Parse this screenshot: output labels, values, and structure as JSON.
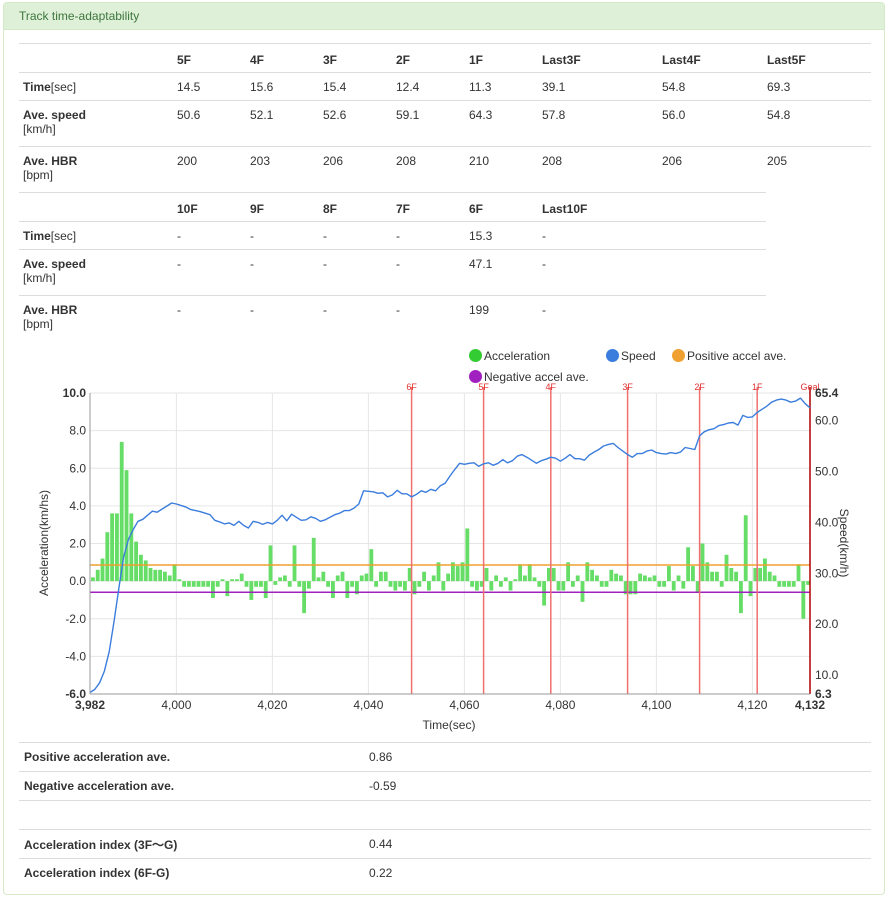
{
  "panel": {
    "title": "Track time-adaptability"
  },
  "table1": {
    "headers": [
      "",
      "5F",
      "4F",
      "3F",
      "2F",
      "1F",
      "Last3F",
      "Last4F",
      "Last5F"
    ],
    "rows": [
      {
        "label": "Time",
        "unit": "[sec]",
        "values": [
          "14.5",
          "15.6",
          "15.4",
          "12.4",
          "11.3",
          "39.1",
          "54.8",
          "69.3"
        ]
      },
      {
        "label": "Ave. speed",
        "unit": "[km/h]",
        "values": [
          "50.6",
          "52.1",
          "52.6",
          "59.1",
          "64.3",
          "57.8",
          "56.0",
          "54.8"
        ]
      },
      {
        "label": "Ave. HBR",
        "unit": "[bpm]",
        "values": [
          "200",
          "203",
          "206",
          "208",
          "210",
          "208",
          "206",
          "205"
        ]
      }
    ]
  },
  "table2": {
    "headers": [
      "",
      "10F",
      "9F",
      "8F",
      "7F",
      "6F",
      "Last10F"
    ],
    "rows": [
      {
        "label": "Time",
        "unit": "[sec]",
        "values": [
          "-",
          "-",
          "-",
          "-",
          "15.3",
          "-"
        ]
      },
      {
        "label": "Ave. speed",
        "unit": "[km/h]",
        "values": [
          "-",
          "-",
          "-",
          "-",
          "47.1",
          "-"
        ]
      },
      {
        "label": "Ave. HBR",
        "unit": "[bpm]",
        "values": [
          "-",
          "-",
          "-",
          "-",
          "199",
          "-"
        ]
      }
    ]
  },
  "legend": {
    "items": [
      {
        "label": "Acceleration",
        "color": "#33cc33"
      },
      {
        "label": "Speed",
        "color": "#3b7ddd"
      },
      {
        "label": "Positive accel ave.",
        "color": "#f0a030"
      },
      {
        "label": "Negative accel ave.",
        "color": "#a020c0"
      }
    ]
  },
  "chart_data": {
    "type": "bar+line",
    "xlabel": "Time(sec)",
    "ylabel_left": "Acceleration(km/hs)",
    "ylabel_right": "Speed(km/h)",
    "x_range": [
      3982,
      4132
    ],
    "x_ticks": [
      {
        "v": 3982,
        "label": "3,982",
        "bold": true
      },
      {
        "v": 4000,
        "label": "4,000"
      },
      {
        "v": 4020,
        "label": "4,020"
      },
      {
        "v": 4040,
        "label": "4,040"
      },
      {
        "v": 4060,
        "label": "4,060"
      },
      {
        "v": 4080,
        "label": "4,080"
      },
      {
        "v": 4100,
        "label": "4,100"
      },
      {
        "v": 4120,
        "label": "4,120"
      },
      {
        "v": 4132,
        "label": "4,132",
        "bold": true
      }
    ],
    "y_left_range": [
      -6.0,
      10.0
    ],
    "y_left_ticks": [
      "-6.0",
      "-4.0",
      "-2.0",
      "0.0",
      "2.0",
      "4.0",
      "6.0",
      "8.0",
      "10.0"
    ],
    "y_right_range": [
      6.3,
      65.4
    ],
    "y_right_ticks": [
      {
        "v": 6.3,
        "label": "6.3",
        "bold": true
      },
      {
        "v": 10,
        "label": "10.0"
      },
      {
        "v": 20,
        "label": "20.0"
      },
      {
        "v": 30,
        "label": "30.0"
      },
      {
        "v": 40,
        "label": "40.0"
      },
      {
        "v": 50,
        "label": "50.0"
      },
      {
        "v": 60,
        "label": "60.0"
      },
      {
        "v": 65.4,
        "label": "65.4",
        "bold": true
      }
    ],
    "markers": [
      {
        "label": "6F",
        "x": 4049
      },
      {
        "label": "5F",
        "x": 4064
      },
      {
        "label": "4F",
        "x": 4078
      },
      {
        "label": "3F",
        "x": 4094
      },
      {
        "label": "2F",
        "x": 4109
      },
      {
        "label": "1F",
        "x": 4121
      },
      {
        "label": "Goal",
        "x": 4132
      }
    ],
    "positive_accel_ave": 0.86,
    "negative_accel_ave": -0.59,
    "acceleration": [
      [
        3982,
        0.2
      ],
      [
        3983,
        0.6
      ],
      [
        3984,
        1.2
      ],
      [
        3985,
        2.6
      ],
      [
        3986,
        3.6
      ],
      [
        3987,
        3.6
      ],
      [
        3988,
        7.4
      ],
      [
        3989,
        5.9
      ],
      [
        3990,
        3.6
      ],
      [
        3991,
        2.1
      ],
      [
        3992,
        1.4
      ],
      [
        3993,
        1.1
      ],
      [
        3994,
        0.7
      ],
      [
        3995,
        0.6
      ],
      [
        3996,
        0.6
      ],
      [
        3997,
        0.5
      ],
      [
        3998,
        0.3
      ],
      [
        3999,
        0.9
      ],
      [
        4000,
        0.1
      ],
      [
        4001,
        -0.3
      ],
      [
        4002,
        -0.3
      ],
      [
        4003,
        -0.3
      ],
      [
        4004,
        -0.3
      ],
      [
        4005,
        -0.3
      ],
      [
        4006,
        -0.3
      ],
      [
        4007,
        -0.9
      ],
      [
        4008,
        -0.3
      ],
      [
        4009,
        0.1
      ],
      [
        4010,
        -0.8
      ],
      [
        4011,
        0.1
      ],
      [
        4012,
        0.1
      ],
      [
        4013,
        0.4
      ],
      [
        4014,
        -0.3
      ],
      [
        4015,
        -1.0
      ],
      [
        4016,
        -0.3
      ],
      [
        4017,
        -0.3
      ],
      [
        4018,
        -0.9
      ],
      [
        4019,
        1.9
      ],
      [
        4020,
        -0.2
      ],
      [
        4021,
        0.2
      ],
      [
        4022,
        0.3
      ],
      [
        4023,
        -0.3
      ],
      [
        4024,
        1.9
      ],
      [
        4025,
        -0.3
      ],
      [
        4026,
        -1.7
      ],
      [
        4027,
        -0.4
      ],
      [
        4028,
        2.3
      ],
      [
        4029,
        0.2
      ],
      [
        4030,
        0.5
      ],
      [
        4031,
        -0.3
      ],
      [
        4032,
        -0.9
      ],
      [
        4033,
        0.3
      ],
      [
        4034,
        0.5
      ],
      [
        4035,
        -0.9
      ],
      [
        4036,
        -0.3
      ],
      [
        4037,
        -0.7
      ],
      [
        4038,
        0.3
      ],
      [
        4039,
        0.4
      ],
      [
        4040,
        1.7
      ],
      [
        4041,
        -0.3
      ],
      [
        4042,
        0.5
      ],
      [
        4043,
        0.5
      ],
      [
        4044,
        -0.3
      ],
      [
        4045,
        -0.5
      ],
      [
        4046,
        -0.3
      ],
      [
        4047,
        -0.5
      ],
      [
        4048,
        0.7
      ],
      [
        4049,
        -0.7
      ],
      [
        4050,
        -0.3
      ],
      [
        4051,
        0.5
      ],
      [
        4052,
        -0.5
      ],
      [
        4053,
        0.3
      ],
      [
        4054,
        1.0
      ],
      [
        4055,
        -0.5
      ],
      [
        4056,
        0.4
      ],
      [
        4057,
        1.0
      ],
      [
        4058,
        0.8
      ],
      [
        4059,
        1.0
      ],
      [
        4060,
        2.8
      ],
      [
        4061,
        -0.3
      ],
      [
        4062,
        -0.5
      ],
      [
        4063,
        -0.3
      ],
      [
        4064,
        0.7
      ],
      [
        4065,
        -0.5
      ],
      [
        4066,
        0.3
      ],
      [
        4067,
        -0.3
      ],
      [
        4068,
        0.2
      ],
      [
        4069,
        -0.5
      ],
      [
        4070,
        0.1
      ],
      [
        4071,
        0.9
      ],
      [
        4072,
        0.3
      ],
      [
        4073,
        0.9
      ],
      [
        4074,
        0.2
      ],
      [
        4075,
        -0.3
      ],
      [
        4076,
        -1.3
      ],
      [
        4077,
        0.7
      ],
      [
        4078,
        0.7
      ],
      [
        4079,
        -0.5
      ],
      [
        4080,
        -0.5
      ],
      [
        4081,
        1.0
      ],
      [
        4082,
        -0.3
      ],
      [
        4083,
        0.3
      ],
      [
        4084,
        -1.1
      ],
      [
        4085,
        1.0
      ],
      [
        4086,
        0.6
      ],
      [
        4087,
        0.3
      ],
      [
        4088,
        -0.3
      ],
      [
        4089,
        -0.3
      ],
      [
        4090,
        0.6
      ],
      [
        4091,
        0.4
      ],
      [
        4092,
        0.3
      ],
      [
        4093,
        -0.7
      ],
      [
        4094,
        -0.7
      ],
      [
        4095,
        -0.7
      ],
      [
        4096,
        0.4
      ],
      [
        4097,
        0.3
      ],
      [
        4098,
        0.2
      ],
      [
        4099,
        0.3
      ],
      [
        4100,
        -0.3
      ],
      [
        4101,
        -0.3
      ],
      [
        4102,
        0.8
      ],
      [
        4103,
        -0.5
      ],
      [
        4104,
        0.3
      ],
      [
        4105,
        -0.4
      ],
      [
        4106,
        1.8
      ],
      [
        4107,
        0.8
      ],
      [
        4108,
        -0.6
      ],
      [
        4109,
        2.0
      ],
      [
        4110,
        1.0
      ],
      [
        4111,
        0.5
      ],
      [
        4112,
        0.5
      ],
      [
        4113,
        -0.3
      ],
      [
        4114,
        1.4
      ],
      [
        4115,
        0.7
      ],
      [
        4116,
        0.5
      ],
      [
        4117,
        -1.7
      ],
      [
        4118,
        3.5
      ],
      [
        4119,
        -0.8
      ],
      [
        4120,
        0.7
      ],
      [
        4121,
        0.7
      ],
      [
        4122,
        1.2
      ],
      [
        4123,
        0.5
      ],
      [
        4124,
        0.3
      ],
      [
        4125,
        -0.3
      ],
      [
        4126,
        -0.3
      ],
      [
        4127,
        -0.3
      ],
      [
        4128,
        -0.3
      ],
      [
        4129,
        0.9
      ],
      [
        4130,
        -2.0
      ],
      [
        4131,
        -0.2
      ]
    ],
    "speed": [
      [
        3982,
        6.6
      ],
      [
        3983,
        7.2
      ],
      [
        3984,
        8.5
      ],
      [
        3985,
        10.8
      ],
      [
        3986,
        14.6
      ],
      [
        3987,
        20.5
      ],
      [
        3988,
        27.0
      ],
      [
        3989,
        33.2
      ],
      [
        3990,
        36.6
      ],
      [
        3991,
        38.6
      ],
      [
        3992,
        40.2
      ],
      [
        3993,
        40.6
      ],
      [
        3994,
        41.4
      ],
      [
        3995,
        42.2
      ],
      [
        3996,
        42.0
      ],
      [
        3997,
        42.6
      ],
      [
        3998,
        43.2
      ],
      [
        3999,
        43.8
      ],
      [
        4000,
        43.6
      ],
      [
        4001,
        43.3
      ],
      [
        4002,
        43.0
      ],
      [
        4003,
        42.5
      ],
      [
        4004,
        42.3
      ],
      [
        4005,
        42.1
      ],
      [
        4006,
        41.8
      ],
      [
        4007,
        41.5
      ],
      [
        4008,
        40.4
      ],
      [
        4009,
        40.1
      ],
      [
        4010,
        39.7
      ],
      [
        4011,
        39.9
      ],
      [
        4012,
        39.4
      ],
      [
        4013,
        40.2
      ],
      [
        4014,
        39.4
      ],
      [
        4015,
        38.9
      ],
      [
        4016,
        40.2
      ],
      [
        4017,
        40.0
      ],
      [
        4018,
        39.6
      ],
      [
        4019,
        40.0
      ],
      [
        4020,
        39.7
      ],
      [
        4021,
        40.4
      ],
      [
        4022,
        41.4
      ],
      [
        4023,
        40.3
      ],
      [
        4024,
        41.6
      ],
      [
        4025,
        41.0
      ],
      [
        4026,
        40.4
      ],
      [
        4027,
        40.5
      ],
      [
        4028,
        41.1
      ],
      [
        4029,
        40.8
      ],
      [
        4030,
        40.2
      ],
      [
        4031,
        40.5
      ],
      [
        4032,
        41.0
      ],
      [
        4033,
        41.5
      ],
      [
        4034,
        41.8
      ],
      [
        4035,
        42.3
      ],
      [
        4036,
        42.3
      ],
      [
        4037,
        42.8
      ],
      [
        4038,
        43.6
      ],
      [
        4039,
        46.2
      ],
      [
        4040,
        46.1
      ],
      [
        4041,
        46.0
      ],
      [
        4042,
        45.7
      ],
      [
        4043,
        45.8
      ],
      [
        4044,
        45.0
      ],
      [
        4045,
        45.4
      ],
      [
        4046,
        46.3
      ],
      [
        4047,
        45.6
      ],
      [
        4048,
        45.6
      ],
      [
        4049,
        45.0
      ],
      [
        4050,
        45.5
      ],
      [
        4051,
        46.2
      ],
      [
        4052,
        45.9
      ],
      [
        4053,
        46.5
      ],
      [
        4054,
        46.2
      ],
      [
        4055,
        47.2
      ],
      [
        4056,
        47.7
      ],
      [
        4057,
        49.1
      ],
      [
        4058,
        50.4
      ],
      [
        4059,
        51.6
      ],
      [
        4060,
        51.4
      ],
      [
        4061,
        51.6
      ],
      [
        4062,
        51.7
      ],
      [
        4063,
        51.0
      ],
      [
        4064,
        51.5
      ],
      [
        4065,
        51.7
      ],
      [
        4066,
        51.2
      ],
      [
        4067,
        51.6
      ],
      [
        4068,
        52.3
      ],
      [
        4069,
        51.7
      ],
      [
        4070,
        52.1
      ],
      [
        4071,
        53.0
      ],
      [
        4072,
        53.3
      ],
      [
        4073,
        52.8
      ],
      [
        4074,
        52.2
      ],
      [
        4075,
        51.6
      ],
      [
        4076,
        52.1
      ],
      [
        4077,
        52.4
      ],
      [
        4078,
        52.8
      ],
      [
        4079,
        52.6
      ],
      [
        4080,
        52.0
      ],
      [
        4081,
        52.6
      ],
      [
        4082,
        53.3
      ],
      [
        4083,
        52.5
      ],
      [
        4084,
        52.5
      ],
      [
        4085,
        52.2
      ],
      [
        4086,
        53.2
      ],
      [
        4087,
        53.8
      ],
      [
        4088,
        54.3
      ],
      [
        4089,
        55.0
      ],
      [
        4090,
        55.3
      ],
      [
        4091,
        55.5
      ],
      [
        4092,
        54.7
      ],
      [
        4093,
        54.0
      ],
      [
        4094,
        53.3
      ],
      [
        4095,
        52.8
      ],
      [
        4096,
        53.5
      ],
      [
        4097,
        53.5
      ],
      [
        4098,
        54.0
      ],
      [
        4099,
        54.2
      ],
      [
        4100,
        53.7
      ],
      [
        4101,
        53.5
      ],
      [
        4102,
        53.4
      ],
      [
        4103,
        53.7
      ],
      [
        4104,
        53.5
      ],
      [
        4105,
        53.8
      ],
      [
        4106,
        54.7
      ],
      [
        4107,
        54.5
      ],
      [
        4108,
        54.3
      ],
      [
        4109,
        57.0
      ],
      [
        4110,
        57.8
      ],
      [
        4111,
        58.2
      ],
      [
        4112,
        58.4
      ],
      [
        4113,
        59.0
      ],
      [
        4114,
        59.2
      ],
      [
        4115,
        59.5
      ],
      [
        4116,
        59.6
      ],
      [
        4117,
        59.1
      ],
      [
        4118,
        61.0
      ],
      [
        4119,
        60.6
      ],
      [
        4120,
        60.7
      ],
      [
        4121,
        61.6
      ],
      [
        4122,
        62.2
      ],
      [
        4123,
        62.8
      ],
      [
        4124,
        63.6
      ],
      [
        4125,
        64.0
      ],
      [
        4126,
        64.2
      ],
      [
        4127,
        64.0
      ],
      [
        4128,
        63.6
      ],
      [
        4129,
        63.8
      ],
      [
        4130,
        64.4
      ],
      [
        4131,
        63.3
      ],
      [
        4132,
        62.5
      ]
    ]
  },
  "summary": {
    "rows": [
      {
        "label": "Positive acceleration ave.",
        "value": "0.86"
      },
      {
        "label": "Negative acceleration ave.",
        "value": "-0.59"
      },
      {
        "label": "",
        "value": ""
      },
      {
        "label": "Acceleration index (3F～G)",
        "value": "0.44"
      },
      {
        "label": "Acceleration index (6F-G)",
        "value": "0.22"
      }
    ]
  }
}
